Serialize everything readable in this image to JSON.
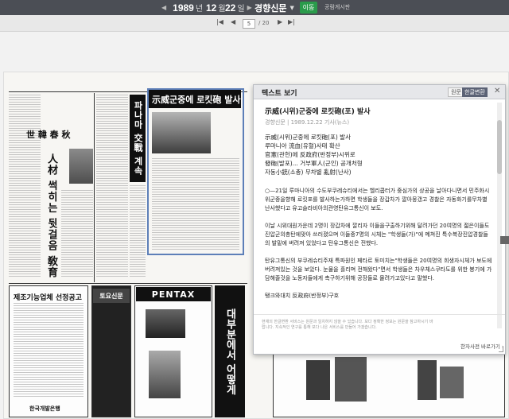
{
  "toolbar": {
    "year": "1989",
    "year_unit": "년",
    "month": "12",
    "month_unit": "월",
    "day": "22",
    "day_unit": "일",
    "newspaper": "경향신문",
    "go_label": "이동",
    "link_label": "공람게시판"
  },
  "page_nav": {
    "current_page": "5",
    "total": "/ 20"
  },
  "newspaper_page": {
    "headline": "示威군중에 로킷砲 발사",
    "column_title": "파나마 交戰 계속",
    "side_title": "人材 썩히는 뒷걸음 敎育",
    "masthead": "世 韓 春 秋",
    "ad1": "토요신문",
    "ad2": "PENTAX",
    "ad3": "대부분에서 어떻게",
    "notice_title": "제조기능업체 선정공고",
    "bank": "한국개발은행"
  },
  "popup": {
    "title": "텍스트 보기",
    "btn_original": "원문",
    "btn_convert": "한글변환",
    "close": "✕",
    "article_title": "示威(시위)군중에 로킷砲(포) 발사",
    "meta": "경향신문 | 1989.12.22 기사(뉴스)",
    "summary_lines": [
      "示威(시위)군중에 로킷砲(포) 발사",
      "루마니아 流血(유혈)사태 확산",
      "官憲(관헌)에 反政府(반정부)시위로",
      "發砲(발포)... 거부軍人(군인) 공개처형",
      "자동小銃(소총) 무차별 亂射(난사)"
    ],
    "paragraphs": [
      "○—21일 루마니아의 수도부쿠레슈티에서는 헬리콥터가 중심가의 상공을 날아다니면서 민주화시위군중을향해 로킷포를 발사하는가하면 학생들을 장갑차가 깔아뭉갰고 경찰은 자동화기를무차별 난사했다고 유고슬라비아의관영탄유그통신이 보도.",
      "이날 시위대원가운데 2명이 장갑차에 깔리자 이들을구출하기위해 달려가던 20여명의 젊은이들도 진압군의총탄에맞아 쓰러졌으며 이들중7명의 시체는 \"학생들(가)\"에 메쳐진 특수복장진압경찰들의 발밑에 버려져 있었다고 탄유그통신은 전했다.",
      "탄유그통신의 부쿠레슈티주재 특파원인 페타르 토미치는\"학생들은 20여명의 희생자시체가 보도에 버려져있는 것을 보았다. 눈물을 흘리며 전해왔다\"면서 학생들은 차우체스쿠타도를 위한 봉기에 가담해줄것을 노동자들에게 촉구하기위해 공장들로 몰려가고있다고 말했다.",
      "탱크와대치 反政府(반정부)구호"
    ],
    "footer_note": "현재의 한글변환 서비스는 원문과 일치하지 않을 수 있습니다. 보다 정확한 정보는 원문을 참고하시기 바랍니다. 지속적인 연구를 통해 보다 나은 서비스를 만들어 가겠습니다.",
    "footer_link": "한자사전 바로가기 ›"
  }
}
